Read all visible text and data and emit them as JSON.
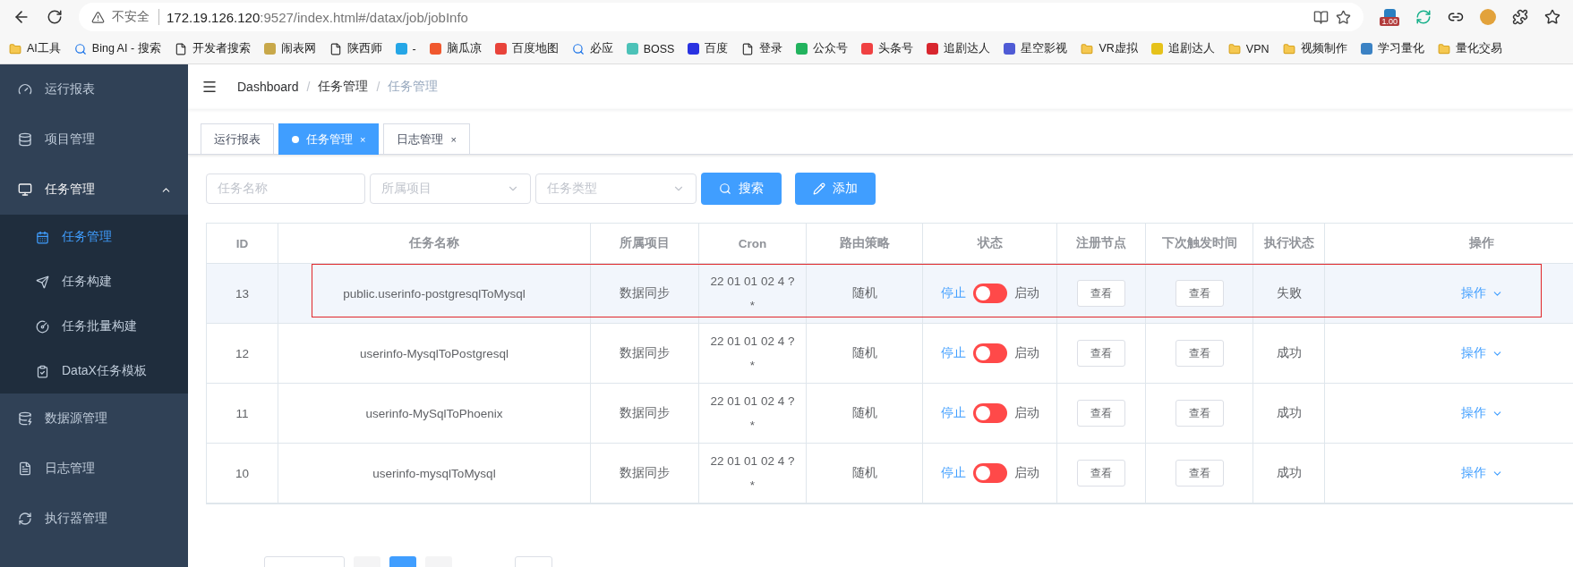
{
  "browser": {
    "security": "不安全",
    "url_host": "172.19.126.120",
    "url_rest": ":9527/index.html#/datax/job/jobInfo",
    "extension_badge": "1.00",
    "bookmarks": [
      {
        "label": "AI工具",
        "kind": "folder"
      },
      {
        "label": "Bing AI - 搜索",
        "kind": "search"
      },
      {
        "label": "开发者搜索",
        "kind": "page"
      },
      {
        "label": "闹表网",
        "kind": "app",
        "color": "#c8a84a"
      },
      {
        "label": "陕西师",
        "kind": "page"
      },
      {
        "label": "-",
        "kind": "app",
        "color": "#25a6e6"
      },
      {
        "label": "脑瓜凉",
        "kind": "app",
        "color": "#f0582e"
      },
      {
        "label": "百度地图",
        "kind": "app",
        "color": "#e8433a"
      },
      {
        "label": "必应",
        "kind": "search"
      },
      {
        "label": "BOSS",
        "kind": "app",
        "color": "#4cc2b8"
      },
      {
        "label": "百度",
        "kind": "app",
        "color": "#2932e1"
      },
      {
        "label": "登录",
        "kind": "page"
      },
      {
        "label": "公众号",
        "kind": "app",
        "color": "#22b35e"
      },
      {
        "label": "头条号",
        "kind": "app",
        "color": "#f04142"
      },
      {
        "label": "追剧达人",
        "kind": "app",
        "color": "#d8262e"
      },
      {
        "label": "星空影视",
        "kind": "app",
        "color": "#4f5bd5"
      },
      {
        "label": "VR虚拟",
        "kind": "folder"
      },
      {
        "label": "追剧达人",
        "kind": "app",
        "color": "#e6c21a"
      },
      {
        "label": "VPN",
        "kind": "folder"
      },
      {
        "label": "视频制作",
        "kind": "folder"
      },
      {
        "label": "学习量化",
        "kind": "app",
        "color": "#3b82c4"
      },
      {
        "label": "量化交易",
        "kind": "folder"
      }
    ]
  },
  "sidebar": {
    "items": [
      {
        "label": "运行报表"
      },
      {
        "label": "项目管理"
      },
      {
        "label": "任务管理",
        "expanded": true,
        "children": [
          {
            "label": "任务管理",
            "selected": true
          },
          {
            "label": "任务构建",
            "selected": false
          },
          {
            "label": "任务批量构建",
            "selected": false
          },
          {
            "label": "DataX任务模板",
            "selected": false
          }
        ]
      },
      {
        "label": "数据源管理"
      },
      {
        "label": "日志管理"
      },
      {
        "label": "执行器管理"
      }
    ]
  },
  "breadcrumb": {
    "separator": "/",
    "items": [
      "Dashboard",
      "任务管理",
      "任务管理"
    ]
  },
  "tabs": [
    {
      "label": "运行报表",
      "selected": false
    },
    {
      "label": "任务管理",
      "selected": true,
      "close": "×"
    },
    {
      "label": "日志管理",
      "selected": false,
      "close": "×"
    }
  ],
  "filters": {
    "name_placeholder": "任务名称",
    "project_placeholder": "所属项目",
    "type_placeholder": "任务类型",
    "search_button": "搜索",
    "add_button": "添加"
  },
  "table": {
    "columns": [
      "ID",
      "任务名称",
      "所属项目",
      "Cron",
      "路由策略",
      "状态",
      "注册节点",
      "下次触发时间",
      "执行状态",
      "操作"
    ],
    "rows": [
      {
        "id": "13",
        "name": "public.userinfo-postgresqlToMysql",
        "project": "数据同步",
        "cron": [
          "22 01 01 02 4 ?",
          "*"
        ],
        "route": "随机",
        "stop": "停止",
        "on": false,
        "start": "启动",
        "nodes": "查看",
        "next": "查看",
        "exec": "失败",
        "action": "操作",
        "highlighted": true
      },
      {
        "id": "12",
        "name": "userinfo-MysqlToPostgresql",
        "project": "数据同步",
        "cron": [
          "22 01 01 02 4 ?",
          "*"
        ],
        "route": "随机",
        "stop": "停止",
        "on": false,
        "start": "启动",
        "nodes": "查看",
        "next": "查看",
        "exec": "成功",
        "action": "操作",
        "highlighted": false
      },
      {
        "id": "11",
        "name": "userinfo-MySqlToPhoenix",
        "project": "数据同步",
        "cron": [
          "22 01 01 02 4 ?",
          "*"
        ],
        "route": "随机",
        "stop": "停止",
        "on": false,
        "start": "启动",
        "nodes": "查看",
        "next": "查看",
        "exec": "成功",
        "action": "操作",
        "highlighted": false
      },
      {
        "id": "10",
        "name": "userinfo-mysqlToMysql",
        "project": "数据同步",
        "cron": [
          "22 01 01 02 4 ?",
          "*"
        ],
        "route": "随机",
        "stop": "停止",
        "on": false,
        "start": "启动",
        "nodes": "查看",
        "next": "查看",
        "exec": "成功",
        "action": "操作",
        "highlighted": false
      }
    ]
  }
}
